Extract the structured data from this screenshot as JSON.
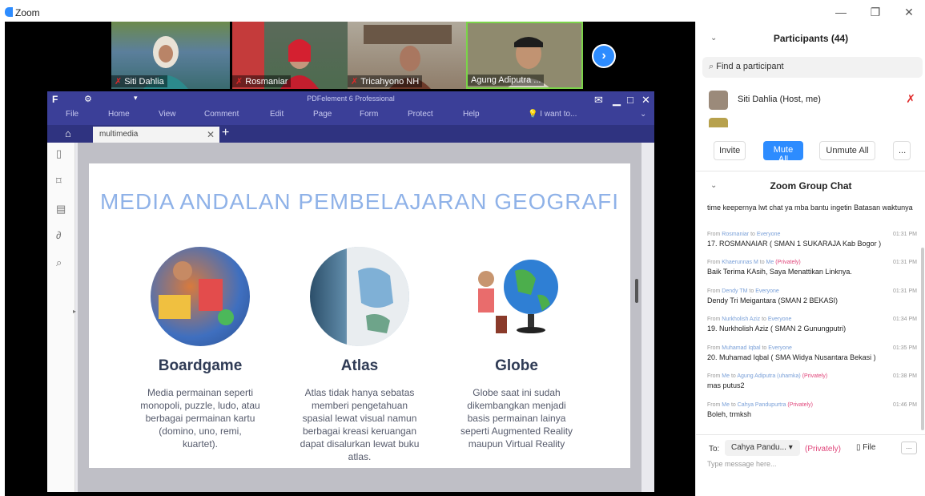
{
  "window": {
    "title": "Zoom",
    "minimize": "—",
    "restore": "❐",
    "close": "✕"
  },
  "gallery": {
    "participants": [
      {
        "name": "Siti Dahlia"
      },
      {
        "name": "Rosmaniar"
      },
      {
        "name": "Tricahyono NH"
      },
      {
        "name": "Agung Adiputra ..."
      }
    ],
    "next_icon": "›"
  },
  "pdf": {
    "app_title": "PDFelement 6 Professional",
    "menu": [
      "File",
      "Home",
      "View",
      "Comment",
      "Edit",
      "Page",
      "Form",
      "Protect",
      "Help"
    ],
    "search_hint": "I want to...",
    "tab_label": "multimedia",
    "slide": {
      "title": "MEDIA ANDALAN PEMBELAJARAN GEOGRAFI",
      "items": [
        {
          "heading": "Boardgame",
          "desc": "Media permainan seperti monopoli, puzzle, ludo, atau berbagai permainan kartu (domino, uno, remi, kuartet)."
        },
        {
          "heading": "Atlas",
          "desc": "Atlas tidak hanya sebatas memberi pengetahuan spasial lewat visual namun berbagai kreasi keruangan dapat disalurkan lewat buku atlas."
        },
        {
          "heading": "Globe",
          "desc": "Globe saat ini sudah dikembangkan menjadi basis permainan lainya seperti Augmented Reality maupun Virtual Reality"
        }
      ]
    }
  },
  "participants_panel": {
    "title": "Participants (44)",
    "search_placeholder": "Find a participant",
    "me": "Siti Dahlia (Host, me)",
    "buttons": {
      "invite": "Invite",
      "mute_all": "Mute All",
      "unmute_all": "Unmute All",
      "more": "..."
    }
  },
  "chat": {
    "title": "Zoom Group Chat",
    "first_msg": "time keepernya lwt chat ya mba bantu ingetin Batasan waktunya",
    "messages": [
      {
        "from": "Rosmaniar",
        "to": "Everyone",
        "private": "",
        "time": "01:31 PM",
        "text": "17. ROSMANAIAR ( SMAN 1 SUKARAJA Kab Bogor )"
      },
      {
        "from": "Khaerunnas M",
        "to": "Me",
        "private": "(Privately)",
        "time": "01:31 PM",
        "text": "Baik Terima KAsih, Saya Menattikan Linknya."
      },
      {
        "from": "Dendy TM",
        "to": "Everyone",
        "private": "",
        "time": "01:31 PM",
        "text": "Dendy Tri Meigantara (SMAN 2 BEKASI)"
      },
      {
        "from": "Nurkholish Aziz",
        "to": "Everyone",
        "private": "",
        "time": "01:34 PM",
        "text": "19. Nurkholish Aziz ( SMAN 2 Gunungputri)"
      },
      {
        "from": "Muhamad Iqbal",
        "to": "Everyone",
        "private": "",
        "time": "01:35 PM",
        "text": "20. Muhamad Iqbal ( SMA Widya Nusantara Bekasi )"
      },
      {
        "from": "Me",
        "to": "Agung Adiputra (uhamka)",
        "private": "(Privately)",
        "time": "01:38 PM",
        "text": "mas putus2"
      },
      {
        "from": "Me",
        "to": "Cahya Pandupurtra",
        "private": "(Privately)",
        "time": "01:46 PM",
        "text": "Boleh, trmksh"
      }
    ],
    "to_label": "To:",
    "to_value": "Cahya Pandu...",
    "to_private": "(Privately)",
    "file_label": "File",
    "more": "...",
    "placeholder": "Type message here..."
  }
}
